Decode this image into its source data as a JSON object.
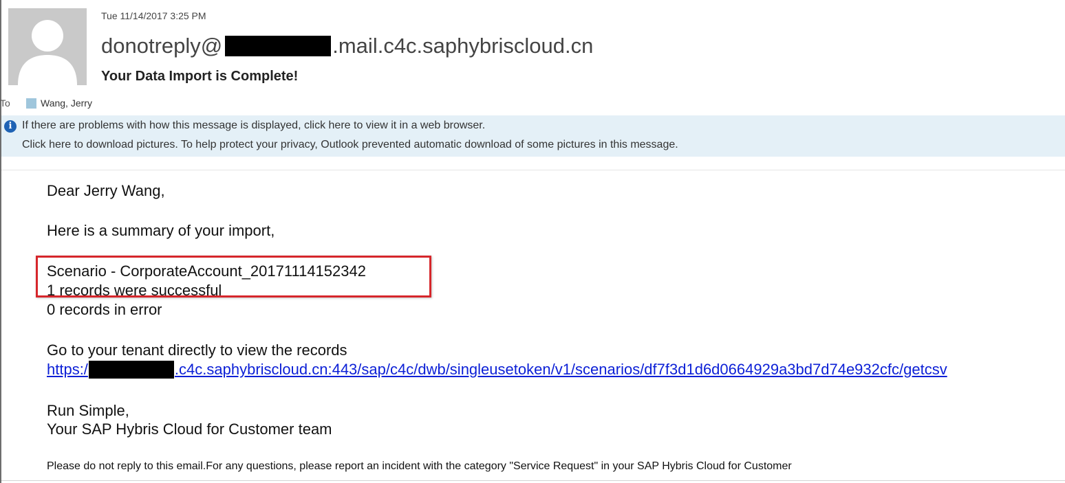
{
  "header": {
    "datetime": "Tue 11/14/2017 3:25 PM",
    "sender_prefix": "donotreply@",
    "sender_suffix": ".mail.c4c.saphybriscloud.cn",
    "subject": "Your Data Import is Complete!",
    "to_label": "To",
    "recipient": "Wang, Jerry"
  },
  "infobar": {
    "line1": "If there are problems with how this message is displayed, click here to view it in a web browser.",
    "line2": "Click here to download pictures. To help protect your privacy, Outlook prevented automatic download of some pictures in this message."
  },
  "body": {
    "greeting": "Dear Jerry Wang,",
    "intro": "Here is a summary of your import,",
    "scenario": "Scenario - CorporateAccount_20171114152342",
    "success": "1 records were successful",
    "errors": "0 records in error",
    "goto": "Go to your tenant directly to view the records",
    "link_prefix": "https:/",
    "link_suffix": ".c4c.saphybriscloud.cn:443/sap/c4c/dwb/singleusetoken/v1/scenarios/df7f3d1d6d0664929a3bd7d74e932cfc/getcsv",
    "signoff": "Run Simple,",
    "team": "Your SAP Hybris Cloud for Customer team",
    "footer": "Please do not reply to this email.For any questions, please report an incident with the category \"Service Request\" in your SAP Hybris Cloud for Customer"
  },
  "colors": {
    "highlight_border": "#d6262b",
    "link": "#0b1fd6",
    "infobar_bg": "#e4f0f7",
    "info_icon": "#1e62b4"
  },
  "icons": {
    "avatar": "person-silhouette-icon",
    "info": "info-icon"
  }
}
